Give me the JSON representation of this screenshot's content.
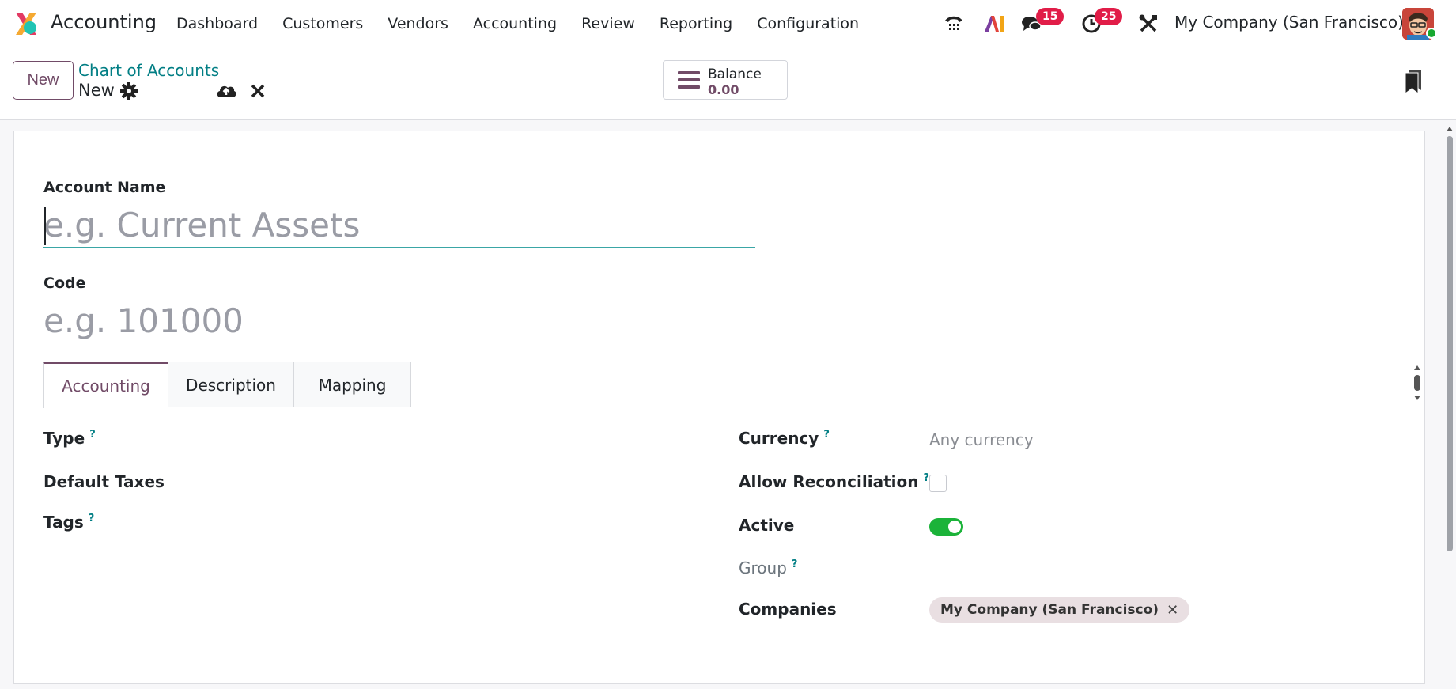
{
  "app": {
    "title": "Accounting"
  },
  "menu": [
    "Dashboard",
    "Customers",
    "Vendors",
    "Accounting",
    "Review",
    "Reporting",
    "Configuration"
  ],
  "systray": {
    "messages_count": "15",
    "activities_count": "25",
    "company": "My Company (San Francisco)",
    "icons": [
      "phone-icon",
      "ai-icon",
      "chat-icon",
      "clock-icon",
      "tools-icon"
    ]
  },
  "control": {
    "new_label": "New",
    "breadcrumb": "Chart of Accounts",
    "record_name": "New",
    "balance_label": "Balance",
    "balance_value": "0.00"
  },
  "form": {
    "account_name_label": "Account Name",
    "account_name_placeholder": "e.g. Current Assets",
    "code_label": "Code",
    "code_placeholder": "e.g. 101000",
    "tabs": [
      "Accounting",
      "Description",
      "Mapping"
    ],
    "left": {
      "type": "Type",
      "default_taxes": "Default Taxes",
      "tags": "Tags"
    },
    "right": {
      "currency": "Currency",
      "currency_value": "Any currency",
      "allow_reconciliation": "Allow Reconciliation",
      "active": "Active",
      "group": "Group",
      "companies": "Companies",
      "company_tag": "My Company (San Francisco)"
    },
    "help_mark": "?",
    "remove_mark": "✕"
  },
  "colors": {
    "brand": "#714b67",
    "link": "#017e84",
    "badge": "#e11d48",
    "toggle_on": "#1bb339"
  }
}
